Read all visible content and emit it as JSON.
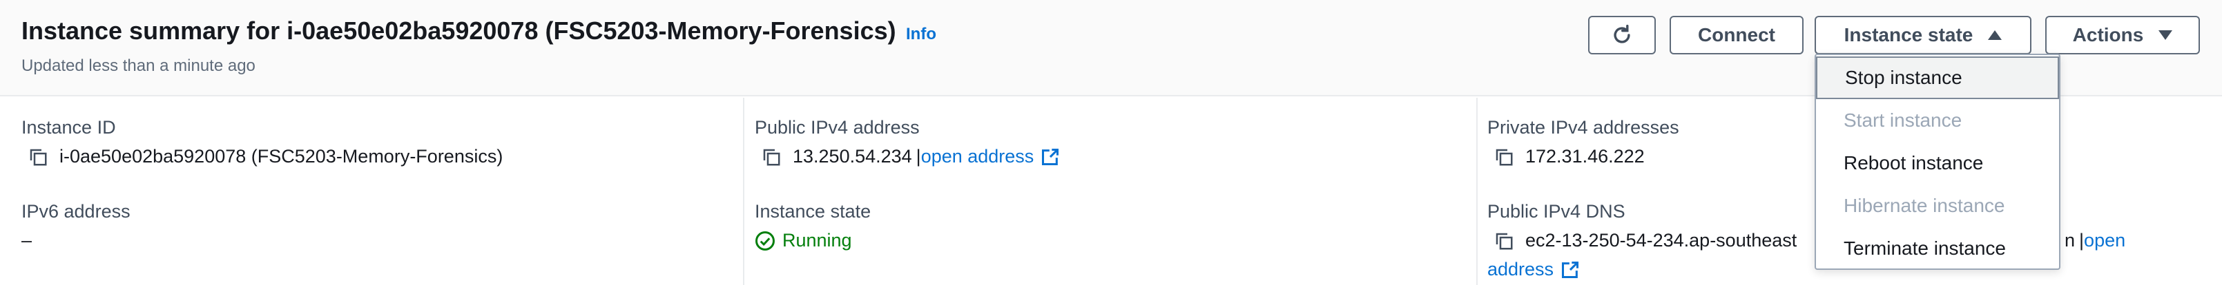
{
  "header": {
    "title": "Instance summary for i-0ae50e02ba5920078 (FSC5203-Memory-Forensics)",
    "info_label": "Info",
    "subtitle": "Updated less than a minute ago"
  },
  "toolbar": {
    "refresh_icon": "refresh-icon",
    "connect_label": "Connect",
    "instance_state_label": "Instance state",
    "actions_label": "Actions"
  },
  "dropdown": {
    "items": [
      {
        "label": "Stop instance",
        "enabled": true,
        "highlighted": true
      },
      {
        "label": "Start instance",
        "enabled": false
      },
      {
        "label": "Reboot instance",
        "enabled": true
      },
      {
        "label": "Hibernate instance",
        "enabled": false
      },
      {
        "label": "Terminate instance",
        "enabled": true
      }
    ]
  },
  "details": {
    "instance_id": {
      "label": "Instance ID",
      "value": "i-0ae50e02ba5920078 (FSC5203-Memory-Forensics)"
    },
    "ipv6": {
      "label": "IPv6 address",
      "value": "–"
    },
    "public_ipv4": {
      "label": "Public IPv4 address",
      "value": "13.250.54.234",
      "separator": "|",
      "link": "open address"
    },
    "instance_state": {
      "label": "Instance state",
      "value": "Running"
    },
    "private_ipv4": {
      "label": "Private IPv4 addresses",
      "value": "172.31.46.222"
    },
    "public_dns": {
      "label": "Public IPv4 DNS",
      "value": "ec2-13-250-54-234.ap-southeast",
      "value_tail": "n",
      "separator": "|",
      "link_part1": "open",
      "link_part2": "address"
    }
  },
  "colors": {
    "link": "#0972d3",
    "running": "#037f0c",
    "disabled": "#9ba7b6",
    "text": "#16191f",
    "muted": "#5f6b7a"
  }
}
